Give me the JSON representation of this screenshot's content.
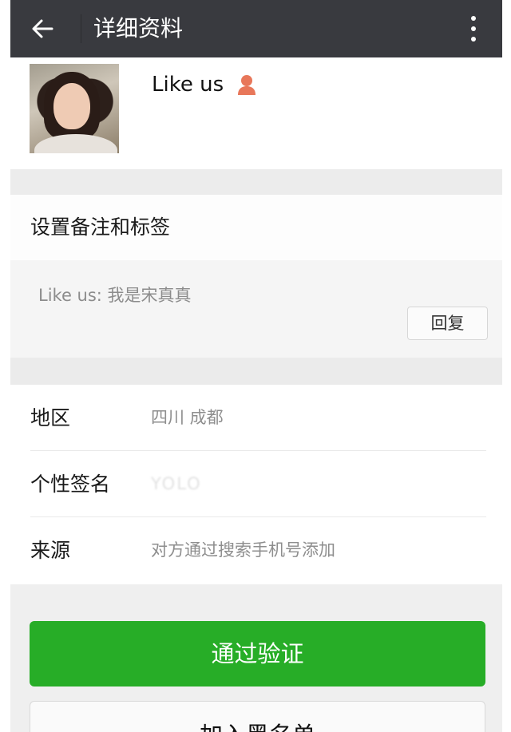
{
  "header": {
    "title": "详细资料",
    "back_icon": "arrow-left-icon",
    "more_icon": "more-vertical-icon"
  },
  "profile": {
    "nickname": "Like us",
    "contact_icon": "person-icon",
    "contact_icon_color": "#e8775a"
  },
  "remark": {
    "label": "设置备注和标签"
  },
  "message": {
    "text": "Like us: 我是宋真真",
    "reply_label": "回复"
  },
  "info": {
    "rows": [
      {
        "label": "地区",
        "value": "四川  成都"
      },
      {
        "label": "个性签名",
        "value": "YOLO"
      },
      {
        "label": "来源",
        "value": "对方通过搜索手机号添加"
      }
    ]
  },
  "actions": {
    "verify_label": "通过验证",
    "blacklist_label": "加入黑名单",
    "verify_color": "#27ad27"
  }
}
